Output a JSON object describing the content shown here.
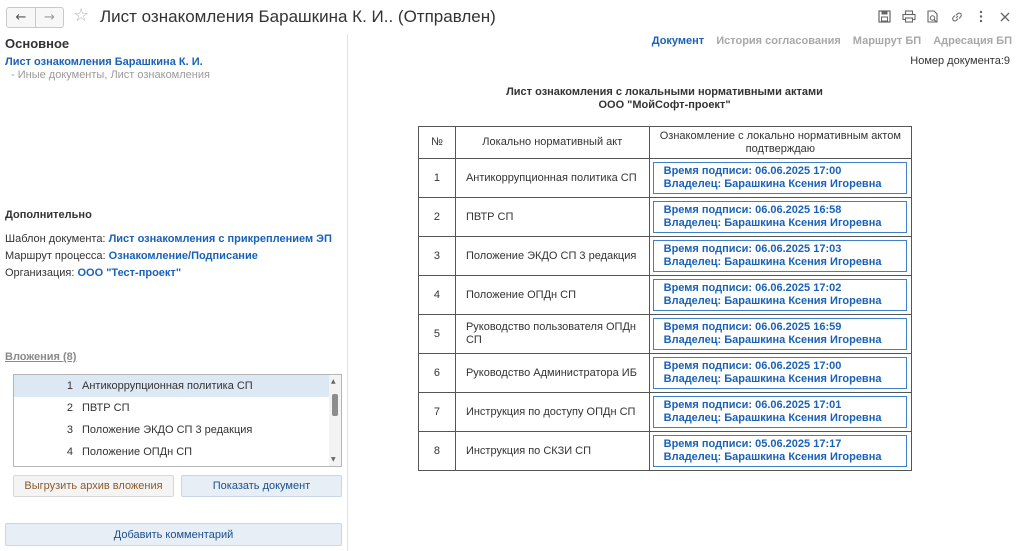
{
  "window": {
    "title": "Лист ознакомления Барашкина К. И.. (Отправлен)",
    "nav": {
      "back_icon": "arrow-left-icon",
      "forward_icon": "arrow-right-icon"
    },
    "toolbar_icons": [
      "save-icon",
      "print-icon",
      "preview-icon",
      "link-icon",
      "more-icon",
      "close-icon"
    ]
  },
  "left": {
    "main_section_title": "Основное",
    "document_link": "Лист ознакомления Барашкина К. И.",
    "document_kind": "- Иные документы, Лист ознакомления",
    "extra_section_title": "Дополнительно",
    "props": [
      {
        "label": "Шаблон документа:",
        "value": "Лист ознакомления с прикреплением ЭП"
      },
      {
        "label": "Маршрут процесса:",
        "value": "Ознакомление/Подписание"
      },
      {
        "label": "Организация:",
        "value": "ООО \"Тест-проект\""
      }
    ],
    "attachments_title": "Вложения (8)",
    "attachments": [
      {
        "num": "1",
        "name": "Антикоррупционная политика СП"
      },
      {
        "num": "2",
        "name": "ПВТР СП"
      },
      {
        "num": "3",
        "name": "Положение ЭКДО СП 3 редакция"
      },
      {
        "num": "4",
        "name": "Положение ОПДн СП"
      }
    ],
    "export_button": "Выгрузить архив вложения",
    "show_button": "Показать документ",
    "comment_button": "Добавить комментарий"
  },
  "right": {
    "tabs": [
      "Документ",
      "История согласования",
      "Маршрут БП",
      "Адресация БП"
    ],
    "doc_number": "Номер документа:9",
    "heading_line1": "Лист ознакомления с локальными нормативными актами",
    "heading_line2": "ООО \"МойСофт-проект\"",
    "table": {
      "headers": [
        "№",
        "Локально нормативный акт",
        "Ознакомление с локально нормативным актом подтверждаю"
      ],
      "rows": [
        {
          "num": "1",
          "act": "Антикоррупционная политика СП",
          "time": "Время подписи: 06.06.2025 17:00",
          "owner": "Владелец: Барашкина Ксения Игоревна"
        },
        {
          "num": "2",
          "act": "ПВТР СП",
          "time": "Время подписи: 06.06.2025 16:58",
          "owner": "Владелец: Барашкина Ксения Игоревна"
        },
        {
          "num": "3",
          "act": "Положение ЭКДО СП 3 редакция",
          "time": "Время подписи: 06.06.2025 17:03",
          "owner": "Владелец: Барашкина Ксения Игоревна"
        },
        {
          "num": "4",
          "act": "Положение ОПДн СП",
          "time": "Время подписи: 06.06.2025 17:02",
          "owner": "Владелец: Барашкина Ксения Игоревна"
        },
        {
          "num": "5",
          "act": "Руководство пользователя ОПДн СП",
          "time": "Время подписи: 06.06.2025 16:59",
          "owner": "Владелец: Барашкина Ксения Игоревна"
        },
        {
          "num": "6",
          "act": "Руководство Администратора ИБ",
          "time": "Время подписи: 06.06.2025 17:00",
          "owner": "Владелец: Барашкина Ксения Игоревна"
        },
        {
          "num": "7",
          "act": "Инструкция по доступу ОПДн СП",
          "time": "Время подписи: 06.06.2025 17:01",
          "owner": "Владелец: Барашкина Ксения Игоревна"
        },
        {
          "num": "8",
          "act": "Инструкция по СКЗИ СП",
          "time": "Время подписи: 05.06.2025 17:17",
          "owner": "Владелец: Барашкина Ксения Игоревна"
        }
      ]
    }
  },
  "colors": {
    "link": "#1a62b8",
    "selection": "#dde8f5",
    "signature_border": "#3f7fcc"
  }
}
